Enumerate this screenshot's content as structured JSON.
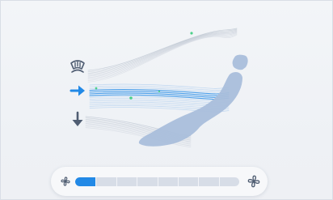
{
  "colors": {
    "accent": "#2289e6",
    "inactive_icon": "#4f5d72",
    "track": "#d7dde7",
    "seat": "#a9bedb",
    "particle": "#4cd08a"
  },
  "airflow": {
    "modes": [
      {
        "id": "defrost",
        "icon": "windshield-defrost-icon",
        "active": false
      },
      {
        "id": "face",
        "icon": "arrow-right-icon",
        "active": true
      },
      {
        "id": "feet",
        "icon": "arrow-down-icon",
        "active": false
      }
    ]
  },
  "fan": {
    "low_icon": "fan-small-icon",
    "high_icon": "fan-large-icon",
    "steps": 8,
    "level": 1
  }
}
